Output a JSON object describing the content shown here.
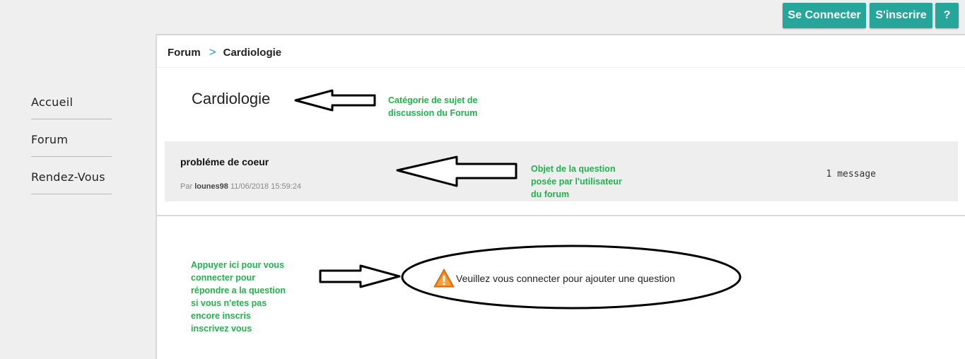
{
  "sidebar": {
    "items": [
      {
        "label": "Accueil"
      },
      {
        "label": "Forum"
      },
      {
        "label": "Rendez-Vous"
      }
    ]
  },
  "topbar": {
    "login_label": "Se Connecter",
    "register_label": "S'inscrire",
    "help_label": "?"
  },
  "breadcrumb": {
    "root": "Forum",
    "separator": ">",
    "current": "Cardiologie"
  },
  "category": {
    "title": "Cardiologie"
  },
  "topic": {
    "title": "probléme de coeur",
    "by_prefix": "Par",
    "author": "lounes98",
    "date": "11/06/2018 15:59:24",
    "count": "1 message"
  },
  "warning": {
    "text": "Veuillez vous connecter pour ajouter une question"
  },
  "annotations": {
    "category_note": [
      "Catégorie de sujet de",
      "discussion du Forum"
    ],
    "topic_note": [
      "Objet de la question",
      "posée par l'utilisateur",
      "du forum"
    ],
    "login_note": [
      "Appuyer ici pour vous",
      "connecter pour",
      "répondre a la question",
      "si vous n'etes pas",
      "encore inscris",
      "inscrivez vous"
    ]
  },
  "colors": {
    "accent": "#26a69a",
    "annotation_green": "#22b14c",
    "breadcrumb_separator": "#2196f3"
  }
}
